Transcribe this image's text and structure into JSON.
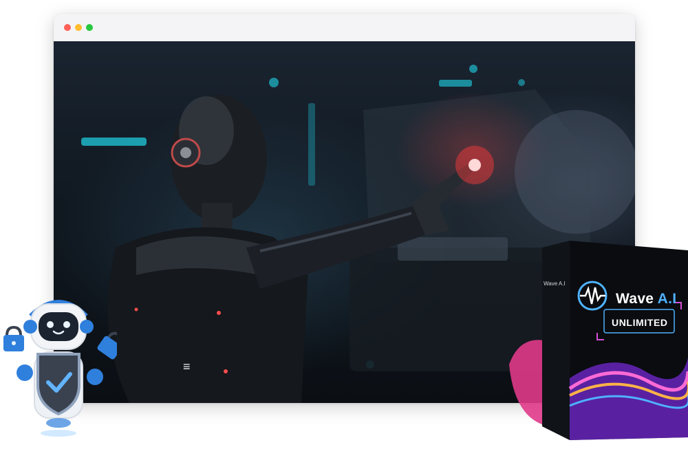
{
  "browser": {
    "window_controls": [
      {
        "name": "close",
        "color": "#ff5f57"
      },
      {
        "name": "minimize",
        "color": "#febc2e"
      },
      {
        "name": "maximize",
        "color": "#28c840"
      }
    ],
    "menu_icon": "≡"
  },
  "product_box": {
    "brand_main": "Wave ",
    "brand_accent": "A.I",
    "spine_label": "Wave A.I",
    "subtitle": "UNLIMITED"
  },
  "colors": {
    "accent_blue": "#4fb2ff",
    "red_glow": "#ff3b3b",
    "mascot_blue": "#2f7fdc"
  },
  "icons": [
    "hamburger-menu-icon",
    "lock-icon",
    "shield-check-icon",
    "wave-logo-icon"
  ]
}
